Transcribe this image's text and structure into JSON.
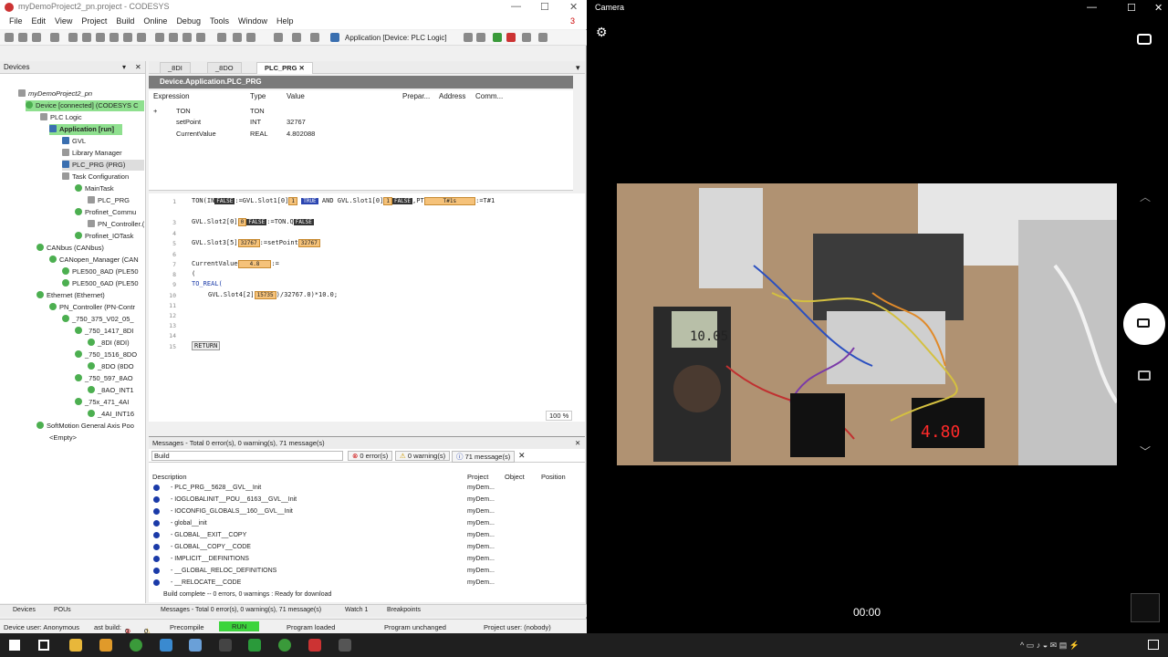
{
  "window": {
    "title": "myDemoProject2_pn.project - CODESYS",
    "alert_count": "3"
  },
  "menu": [
    "File",
    "Edit",
    "View",
    "Project",
    "Build",
    "Online",
    "Debug",
    "Tools",
    "Window",
    "Help"
  ],
  "toolbar": {
    "application_label": "Application [Device: PLC Logic]"
  },
  "devices_panel": {
    "title": "Devices",
    "tree": [
      "myDemoProject2_pn",
      "Device [connected] (CODESYS C",
      "PLC Logic",
      "Application [run]",
      "GVL",
      "Library Manager",
      "PLC_PRG (PRG)",
      "Task Configuration",
      "MainTask",
      "PLC_PRG",
      "Profinet_Commu",
      "PN_Controller.(",
      "Profinet_IOTask",
      "CANbus (CANbus)",
      "CANopen_Manager (CAN",
      "PLE500_8AD (PLE50",
      "PLE500_6AD (PLE50",
      "Ethernet (Ethernet)",
      "PN_Controller (PN-Contr",
      "_750_375_V02_05_",
      "_750_1417_8DI",
      "_8DI (8DI)",
      "_750_1516_8DO",
      "_8DO (8DO",
      "_750_597_8AO",
      "_8AO_INT1",
      "_75x_471_4AI",
      "_4AI_INT16",
      "SoftMotion General Axis Poo",
      "<Empty>"
    ]
  },
  "tabs": [
    "_8DI",
    "_8DO",
    "PLC_PRG"
  ],
  "pou": {
    "title": "Device.Application.PLC_PRG"
  },
  "watch": {
    "headers": [
      "Expression",
      "Type",
      "Value",
      "Prepar...",
      "Address",
      "Comm..."
    ],
    "rows": [
      {
        "expr": "TON",
        "type": "TON",
        "value": ""
      },
      {
        "expr": "setPoint",
        "type": "INT",
        "value": "32767"
      },
      {
        "expr": "CurrentValue",
        "type": "REAL",
        "value": "4.802088"
      }
    ]
  },
  "code": {
    "line_numbers": [
      "1",
      "2",
      "3",
      "4",
      "5",
      "6",
      "7",
      "8",
      "9",
      "10",
      "11",
      "12",
      "13",
      "14",
      "15"
    ],
    "l1a": "TON(IN",
    "l1b": ":=GVL.Slot1[0]",
    "l1c": "AND GVL.Slot1[0]",
    "l1d": ",PT",
    "l1e": ":=T#1",
    "l3a": "GVL.Slot2[0]",
    "l3b": ":=TON.Q",
    "l5a": "GVL.Slot3[5]",
    "l5b": ":=setPoint",
    "l7a": "CurrentValue",
    "l7b": ":=",
    "l8": "(",
    "l9": "TO_REAL(",
    "l10a": "GVL.Slot4[2]",
    "l10b": ")/32767.0)*10.0;",
    "l15": "RETURN",
    "v_false": "FALSE",
    "v_true": "TRUE",
    "v_1": "1",
    "v_0": "0",
    "v_t1s": "T#1s",
    "v_32767": "32767",
    "v_48": "4.8",
    "v_15735": "15735"
  },
  "zoom": "100 %",
  "messages": {
    "title": "Messages - Total 0 error(s), 0 warning(s), 71 message(s)",
    "filter": "Build",
    "errors": "0 error(s)",
    "warnings": "0 warning(s)",
    "infos": "71 message(s)",
    "headers": [
      "Description",
      "Project",
      "Object",
      "Position"
    ],
    "rows": [
      {
        "desc": "- PLC_PRG__5628__GVL__Init",
        "project": "myDem..."
      },
      {
        "desc": "- IOGLOBALINIT__POU__6163__GVL__Init",
        "project": "myDem..."
      },
      {
        "desc": "- IOCONFIG_GLOBALS__160__GVL__Init",
        "project": "myDem..."
      },
      {
        "desc": "- global__init",
        "project": "myDem..."
      },
      {
        "desc": "- GLOBAL__EXIT__COPY",
        "project": "myDem..."
      },
      {
        "desc": "- GLOBAL__COPY__CODE",
        "project": "myDem..."
      },
      {
        "desc": "- IMPLICIT__DEFINITIONS",
        "project": "myDem..."
      },
      {
        "desc": "- __GLOBAL_RELOC_DEFINITIONS",
        "project": "myDem..."
      },
      {
        "desc": "- __RELOCATE__CODE",
        "project": "myDem..."
      }
    ],
    "summary": "Build complete -- 0 errors, 0 warnings : Ready for download"
  },
  "bottom_tabs": {
    "devices": "Devices",
    "pous": "POUs",
    "messages": "Messages - Total 0 error(s), 0 warning(s), 71 message(s)",
    "watch": "Watch 1",
    "breakpoints": "Breakpoints"
  },
  "status": {
    "user": "Device user: Anonymous",
    "last_build": "ast build:",
    "err": "0",
    "warn": "0",
    "precompile": "Precompile",
    "run": "RUN",
    "loaded": "Program loaded",
    "unchanged": "Program unchanged",
    "project_user": "Project user: (nobody)"
  },
  "camera": {
    "title": "Camera",
    "timer": "00:00",
    "display_reading": "4.80",
    "multimeter_reading": "10.05"
  },
  "colors": {
    "run_green": "#3cd43c",
    "hl_green": "#8fe08f",
    "code_value": "#f5c27a",
    "camera_bg": "#000000"
  }
}
